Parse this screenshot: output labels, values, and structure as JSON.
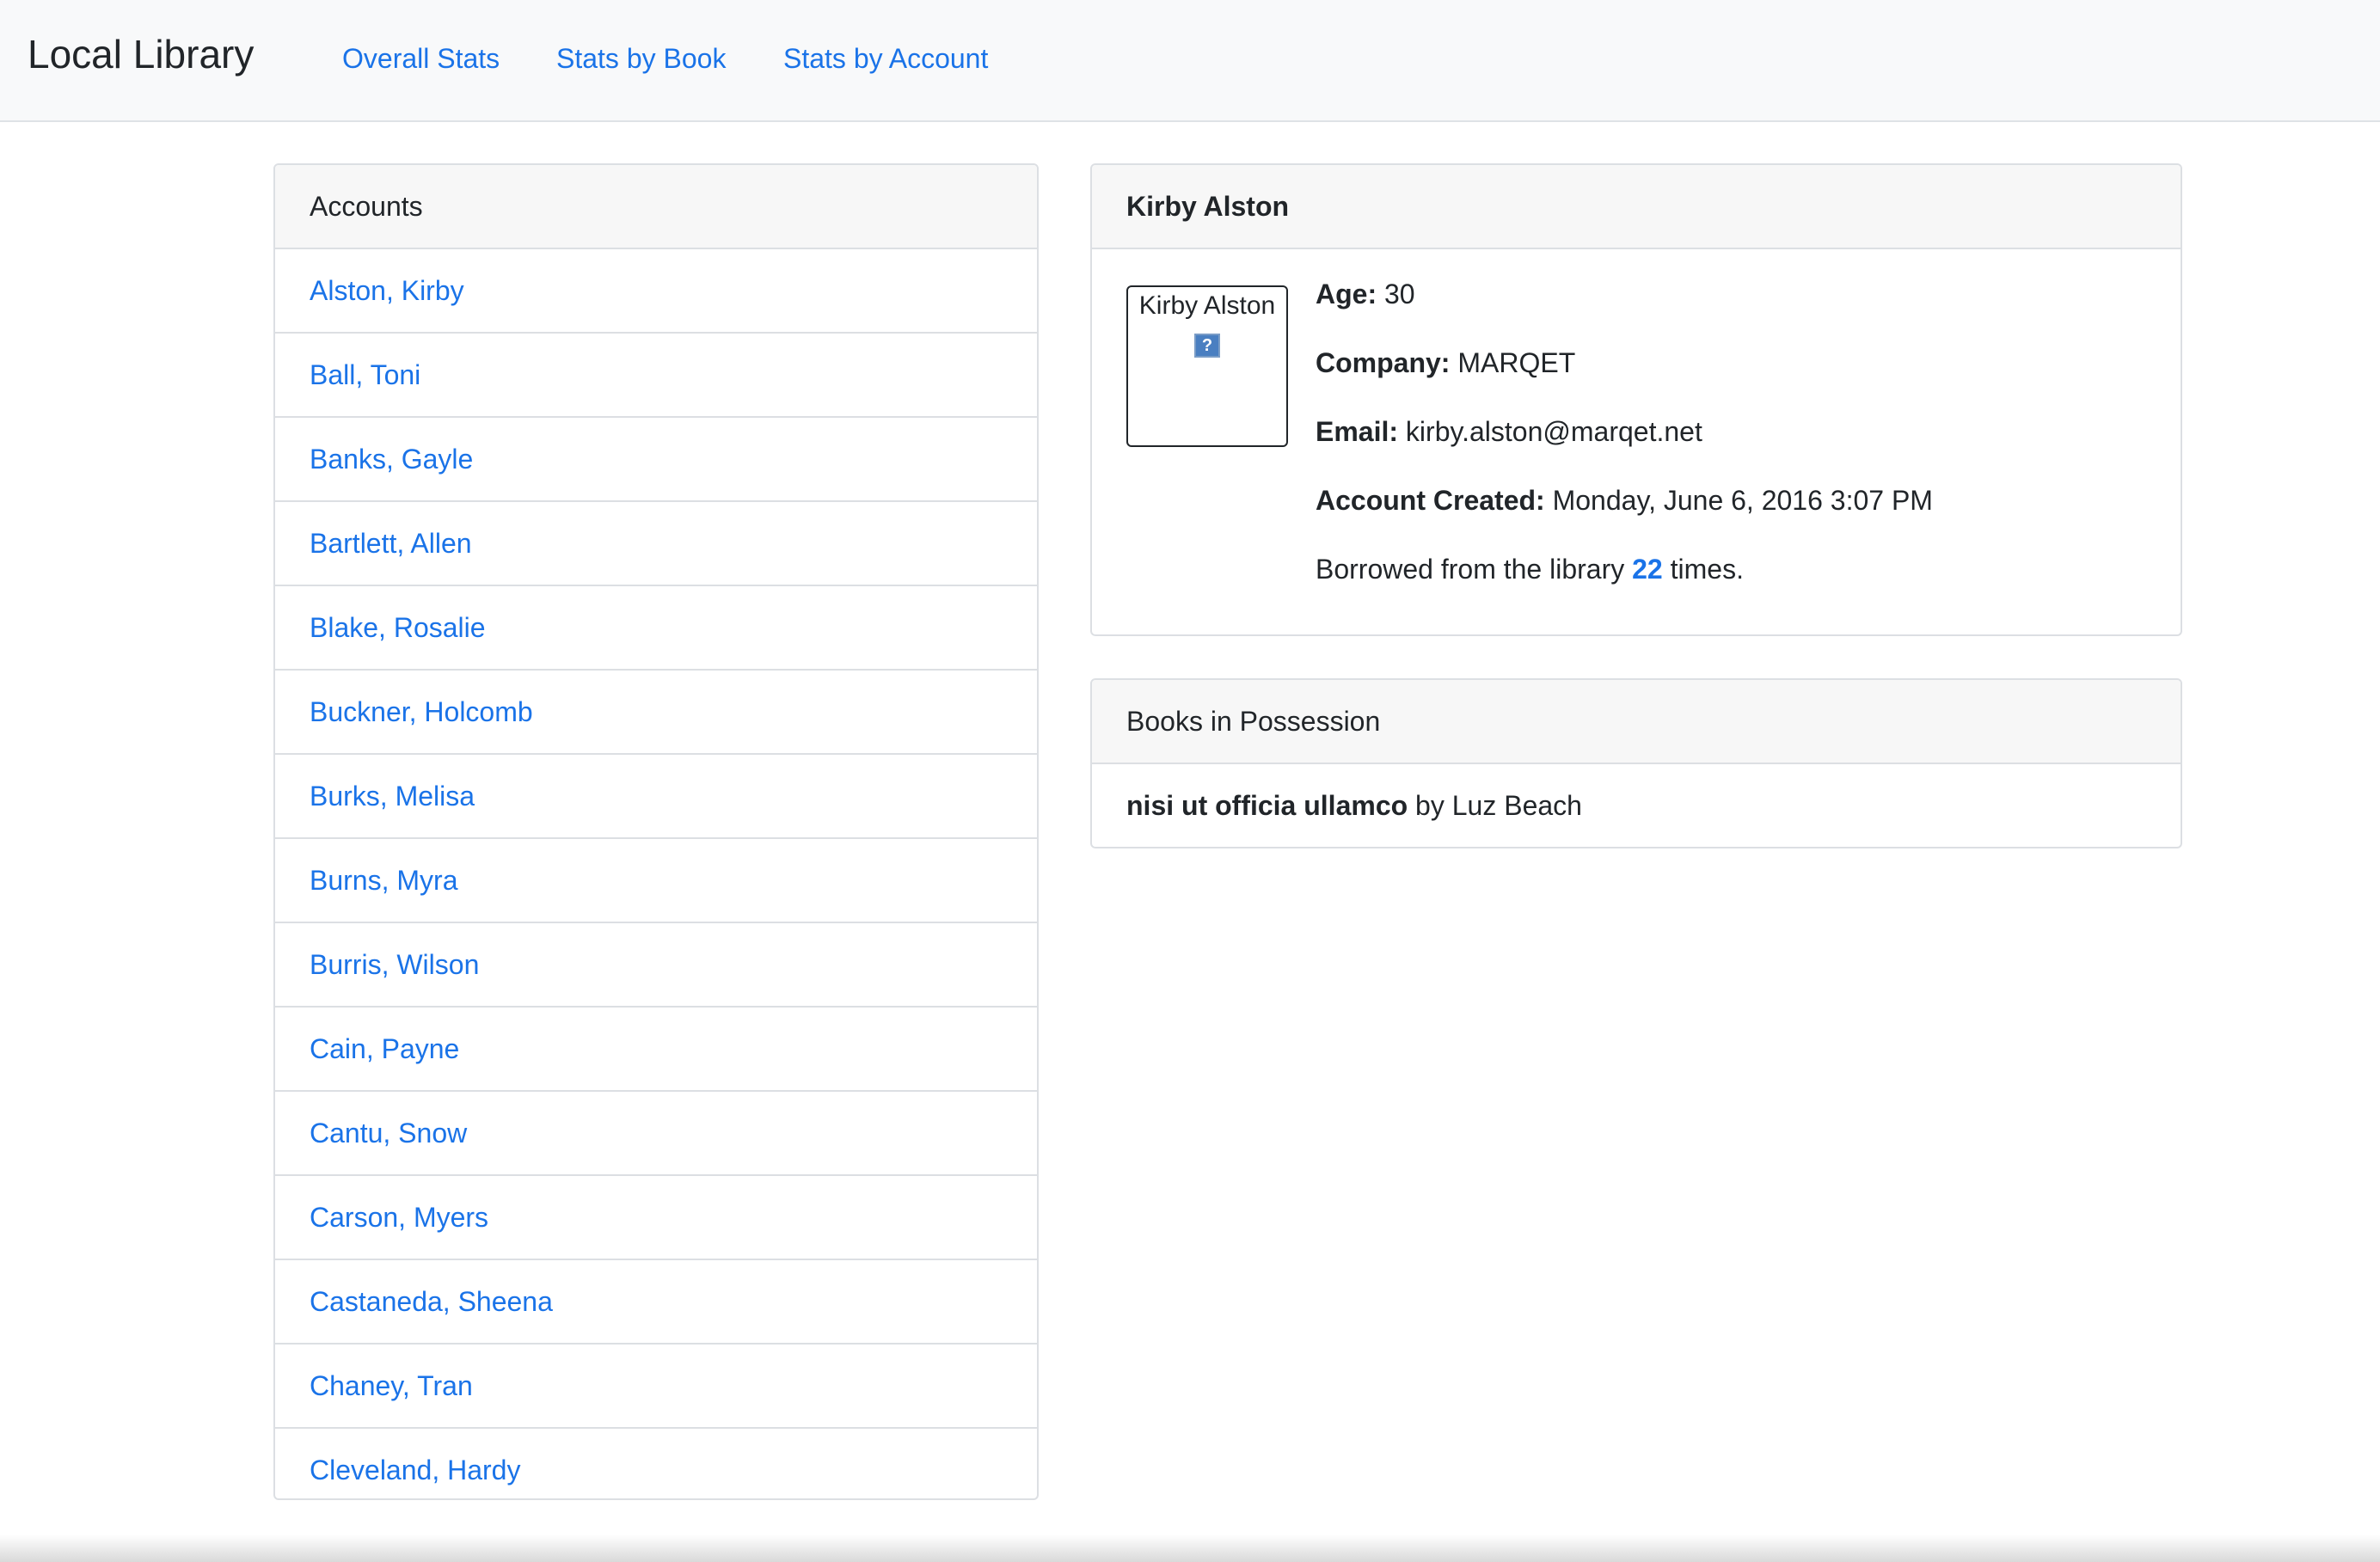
{
  "navbar": {
    "brand": "Local Library",
    "links": [
      "Overall Stats",
      "Stats by Book",
      "Stats by Account"
    ]
  },
  "accounts": {
    "header": "Accounts",
    "items": [
      "Alston, Kirby",
      "Ball, Toni",
      "Banks, Gayle",
      "Bartlett, Allen",
      "Blake, Rosalie",
      "Buckner, Holcomb",
      "Burks, Melisa",
      "Burns, Myra",
      "Burris, Wilson",
      "Cain, Payne",
      "Cantu, Snow",
      "Carson, Myers",
      "Castaneda, Sheena",
      "Chaney, Tran",
      "Cleveland, Hardy"
    ]
  },
  "detail": {
    "name": "Kirby Alston",
    "photo_alt": "Kirby Alston",
    "broken_image_glyph": "?",
    "age_label": "Age:",
    "age": "30",
    "company_label": "Company:",
    "company": "MARQET",
    "email_label": "Email:",
    "email": "kirby.alston@marqet.net",
    "created_label": "Account Created:",
    "created": "Monday, June 6, 2016 3:07 PM",
    "borrowed_prefix": "Borrowed from the library",
    "borrowed_count": "22",
    "borrowed_suffix": "times."
  },
  "books": {
    "header": "Books in Possession",
    "items": [
      {
        "title": "nisi ut officia ullamco",
        "by": "by",
        "author": "Luz Beach"
      }
    ]
  },
  "colors": {
    "link": "#1a73e8",
    "navbar_bg": "#f8f9fa",
    "card_header_bg": "#f7f7f7",
    "border": "#dcdfe3"
  }
}
